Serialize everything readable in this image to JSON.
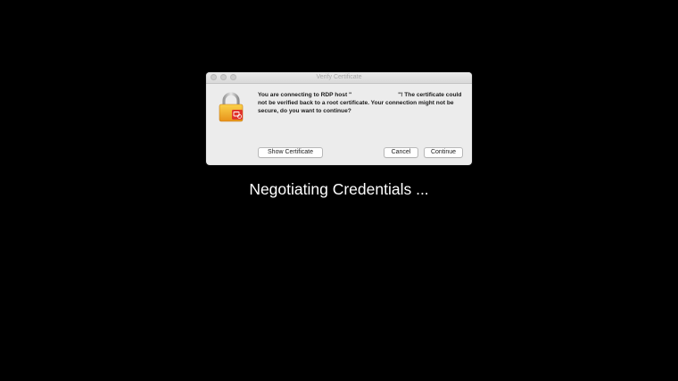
{
  "dialog": {
    "title": "Verify Certificate",
    "message_part1": "You are connecting to RDP host \"",
    "message_part2": "\"! The certificate could not be verified back to a root certificate. Your connection might not be secure, do you want to continue?",
    "show_certificate_label": "Show Certificate",
    "cancel_label": "Cancel",
    "continue_label": "Continue",
    "icon": "lock-certificate-icon"
  },
  "status": {
    "text": "Negotiating Credentials ..."
  },
  "colors": {
    "background": "#000000",
    "dialog_background": "#ececec",
    "lock_body": "#f2a623",
    "badge": "#e0342b"
  }
}
